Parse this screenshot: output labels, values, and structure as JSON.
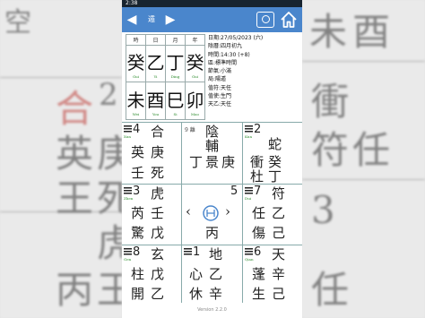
{
  "status": {
    "time": "2:38"
  },
  "appbar": {
    "title": "遁",
    "prev_icon": "◀",
    "next_icon": "▶"
  },
  "pillars": {
    "headers": [
      "時",
      "日",
      "月",
      "年"
    ],
    "stems": [
      "癸",
      "乙",
      "丁",
      "癸"
    ],
    "stems_pinyin": [
      "Gui",
      "Yi",
      "Ding",
      "Gui"
    ],
    "branches": [
      "未",
      "酉",
      "巳",
      "卯"
    ],
    "branches_pinyin": [
      "Wei",
      "You",
      "Si",
      "Mao"
    ]
  },
  "meta": {
    "date": "日期:27/05/2023 (六)",
    "lunar": "陰曆:四月初九",
    "time": "時間:14:30 (+8)",
    "zone": "區:標準時間",
    "term": "節氣:小滿",
    "ju": "局:陽遁",
    "zhifu": "值符:天任",
    "zhishi": "值使:生門",
    "tianyi": "天乙:天任"
  },
  "grid": [
    {
      "number": "4",
      "name": "Xun",
      "deity": "合",
      "star": "英",
      "heaven": "庚",
      "door": "壬",
      "earth": "死"
    },
    {
      "label": "9 離",
      "deity": "陰",
      "star": "輔",
      "heaven": "丁",
      "door": "景",
      "earth": "庚"
    },
    {
      "number": "2",
      "name": "Kun",
      "deity": "蛇",
      "star": "衝",
      "heaven": "癸",
      "door": "杜",
      "earth": "丁"
    },
    {
      "number": "3",
      "name": "Zhen",
      "deity": "虎",
      "star": "芮",
      "heaven": "壬",
      "door": "驚",
      "earth": "戊"
    },
    {
      "number": "5",
      "left_arrow": "‹",
      "right_arrow": "›",
      "earth": "丙"
    },
    {
      "number": "7",
      "name": "Dui",
      "deity": "符",
      "star": "任",
      "heaven": "乙",
      "door": "傷",
      "earth": "己"
    },
    {
      "number": "8",
      "name": "Gen",
      "deity": "玄",
      "star": "柱",
      "heaven": "戊",
      "door": "開",
      "earth": "乙"
    },
    {
      "number": "1",
      "deity": "地",
      "star": "心",
      "heaven": "乙",
      "door": "休",
      "earth": "辛"
    },
    {
      "number": "6",
      "name": "Qian",
      "deity": "天",
      "star": "蓬",
      "heaven": "辛",
      "door": "生",
      "earth": "己"
    }
  ],
  "background": {
    "left": [
      "空",
      "合",
      "2",
      "英",
      "庚",
      "王",
      "死",
      "虎",
      "丙",
      "王"
    ],
    "right": [
      "未",
      "酉",
      "衝",
      "符",
      "任",
      "3",
      "任"
    ]
  },
  "footer": {
    "text": "Version 2.2.0"
  }
}
